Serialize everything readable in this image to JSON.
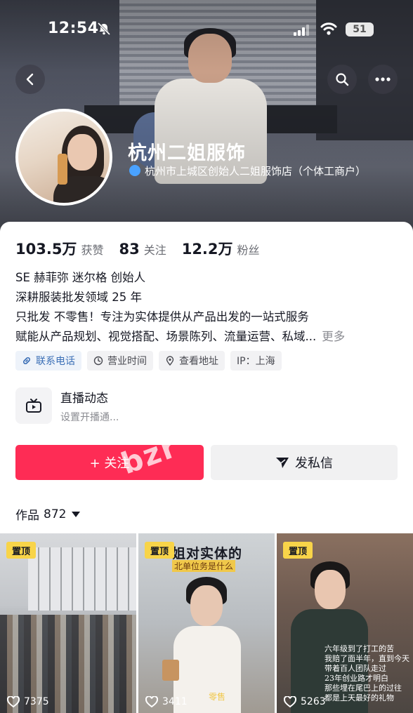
{
  "status_bar": {
    "time": "12:54",
    "battery": "51"
  },
  "profile": {
    "name": "杭州二姐服饰",
    "verified_description": "杭州市上城区创始人二姐服饰店（个体工商户）"
  },
  "stats": [
    {
      "value": "103.5万",
      "label": "获赞"
    },
    {
      "value": "83",
      "label": "关注"
    },
    {
      "value": "12.2万",
      "label": "粉丝"
    }
  ],
  "bio": {
    "lines": [
      "SE  赫菲弥  迷尔格  创始人",
      "深耕服装批发领域 25 年",
      "只批发 不零售！专注为实体提供从产品出发的一站式服务",
      "赋能从产品规划、视觉搭配、场景陈列、流量运营、私域..."
    ],
    "more_label": "更多"
  },
  "tags": [
    {
      "icon": "link-icon",
      "label": "联系电话"
    },
    {
      "icon": "clock-icon",
      "label": "营业时间"
    },
    {
      "icon": "location-icon",
      "label": "查看地址"
    },
    {
      "icon": "",
      "label": "IP：上海"
    }
  ],
  "live": {
    "title": "直播动态",
    "subtitle": "设置开播通..."
  },
  "actions": {
    "follow_label": "+ 关注",
    "message_label": "发私信"
  },
  "watermark": "bzr",
  "works": {
    "label": "作品",
    "count": "872"
  },
  "videos": [
    {
      "pin_label": "置顶",
      "plays": "7375"
    },
    {
      "pin_label": "置顶",
      "plays": "3411",
      "overlay_title": "姐对实体的",
      "overlay_subtitle": "北单位务是什么",
      "caption": "零售"
    },
    {
      "pin_label": "置顶",
      "plays": "5263",
      "overlay_text": "六年级到了打工的苦\n我赔了面半年，直到今天\n带着百人团队走过\n23年创业路才明白\n那些埋在尾巴上的过往\n都是上天最好的礼物"
    }
  ],
  "colors": {
    "accent": "#fe2c55",
    "pin": "#f8d449",
    "link": "#3b6fb6"
  }
}
